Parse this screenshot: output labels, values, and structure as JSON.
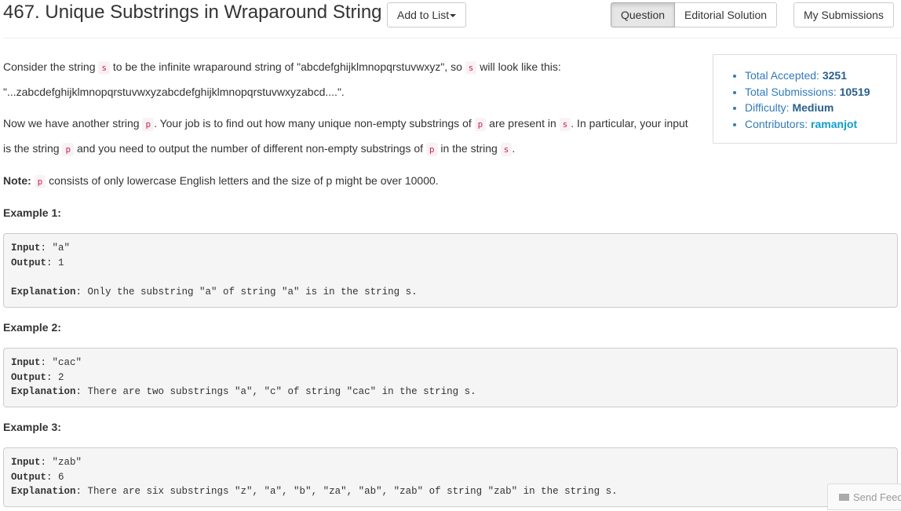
{
  "header": {
    "title": "467. Unique Substrings in Wraparound String",
    "add_to_list": "Add to List",
    "tabs": [
      "Question",
      "Editorial Solution"
    ],
    "my_submissions": "My Submissions"
  },
  "description": {
    "p1_a": "Consider the string ",
    "code_s": "s",
    "code_p": "p",
    "p1_b": " to be the infinite wraparound string of \"abcdefghijklmnopqrstuvwxyz\", so ",
    "p1_c": " will look like this: \"...zabcdefghijklmnopqrstuvwxyzabcdefghijklmnopqrstuvwxyzabcd....\".",
    "p2_a": "Now we have another string ",
    "p2_b": ". Your job is to find out how many unique non-empty substrings of ",
    "p2_c": " are present in ",
    "p2_d": ". In particular, your input is the string ",
    "p2_e": " and you need to output the number of different non-empty substrings of ",
    "p2_f": " in the string ",
    "p2_g": ".",
    "note_label": "Note:",
    "note_text": " consists of only lowercase English letters and the size of p might be over 10000."
  },
  "stats": {
    "accepted_label": "Total Accepted: ",
    "accepted_value": "3251",
    "submissions_label": "Total Submissions: ",
    "submissions_value": "10519",
    "difficulty_label": "Difficulty: ",
    "difficulty_value": "Medium",
    "contributors_label": "Contributors: ",
    "contributors_value": "ramanjot"
  },
  "labels": {
    "input": "Input",
    "output": "Output",
    "explanation": "Explanation"
  },
  "examples": [
    {
      "heading": "Example 1:",
      "input": ": \"a\"",
      "output": ": 1",
      "explanation": ": Only the substring \"a\" of string \"a\" is in the string s."
    },
    {
      "heading": "Example 2:",
      "input": ": \"cac\"",
      "output": ": 2",
      "explanation": ": There are two substrings \"a\", \"c\" of string \"cac\" in the string s."
    },
    {
      "heading": "Example 3:",
      "input": ": \"zab\"",
      "output": ": 6",
      "explanation": ": There are six substrings \"z\", \"a\", \"b\", \"za\", \"ab\", \"zab\" of string \"zab\" in the string s."
    }
  ],
  "feedback": {
    "label": "Send Feedback",
    "icon": "envelope-icon"
  }
}
